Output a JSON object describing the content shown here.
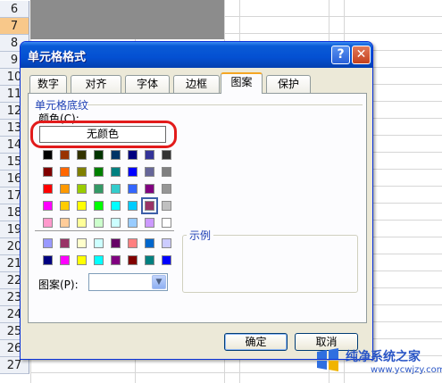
{
  "spreadsheet": {
    "row_numbers": [
      "6",
      "7",
      "8",
      "9",
      "10",
      "11",
      "12",
      "13",
      "14",
      "15",
      "16",
      "17",
      "18",
      "19",
      "20",
      "21",
      "22",
      "23",
      "24",
      "25",
      "26",
      "27"
    ],
    "selected_row": "7"
  },
  "dialog": {
    "title": "单元格格式",
    "help_label": "?",
    "close_label": "✕",
    "tabs": [
      "数字",
      "对齐",
      "字体",
      "边框",
      "图案",
      "保护"
    ],
    "active_tab": "图案",
    "section_title": "单元格底纹",
    "color_label": "颜色(C):",
    "no_color_label": "无颜色",
    "highlight_color": "#e21b1b",
    "palette_main": [
      [
        "#000000",
        "#993300",
        "#333300",
        "#003300",
        "#003366",
        "#000080",
        "#333399",
        "#333333"
      ],
      [
        "#800000",
        "#ff6600",
        "#808000",
        "#008000",
        "#008080",
        "#0000ff",
        "#666699",
        "#808080"
      ],
      [
        "#ff0000",
        "#ff9900",
        "#99cc00",
        "#339966",
        "#33cccc",
        "#3366ff",
        "#800080",
        "#969696"
      ],
      [
        "#ff00ff",
        "#ffcc00",
        "#ffff00",
        "#00ff00",
        "#00ffff",
        "#00ccff",
        "#993366",
        "#c0c0c0"
      ],
      [
        "#ff99cc",
        "#ffcc99",
        "#ffff99",
        "#ccffcc",
        "#ccffff",
        "#99ccff",
        "#cc99ff",
        "#ffffff"
      ]
    ],
    "palette_chart": [
      [
        "#9999ff",
        "#993366",
        "#ffffcc",
        "#ccffff",
        "#660066",
        "#ff8080",
        "#0066cc",
        "#ccccff"
      ],
      [
        "#000080",
        "#ff00ff",
        "#ffff00",
        "#00ffff",
        "#800080",
        "#800000",
        "#008080",
        "#0000ff"
      ]
    ],
    "selected_swatch": "row3-col6",
    "sample_label": "示例",
    "pattern_label": "图案(P):",
    "pattern_value": "",
    "ok_label": "确定",
    "cancel_label": "取消"
  },
  "watermark": {
    "name": "纯净系统之家",
    "url": "www.ycwjzy.com"
  }
}
